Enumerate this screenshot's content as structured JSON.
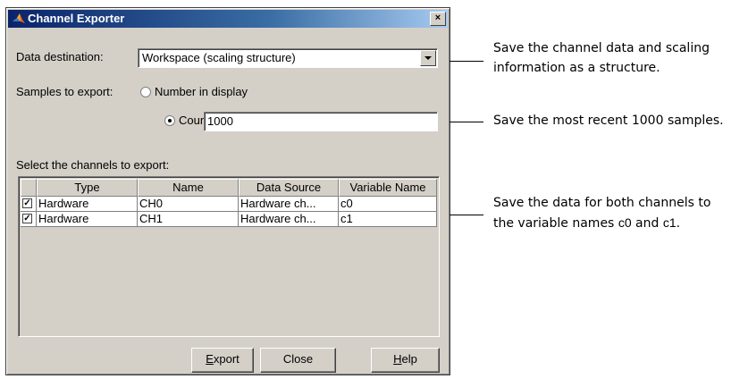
{
  "window": {
    "title": "Channel Exporter",
    "close_glyph": "×"
  },
  "destination": {
    "label": "Data destination:",
    "value": "Workspace (scaling structure)"
  },
  "samples": {
    "label": "Samples to export:",
    "option_display": "Number in display",
    "option_count": "Count",
    "count_value": "1000",
    "selected": "count"
  },
  "channels": {
    "label": "Select the channels to export:",
    "columns": [
      "Type",
      "Name",
      "Data Source",
      "Variable Name"
    ],
    "rows": [
      {
        "checked": true,
        "type": "Hardware",
        "name": "CH0",
        "source": "Hardware ch...",
        "variable": "c0"
      },
      {
        "checked": true,
        "type": "Hardware",
        "name": "CH1",
        "source": "Hardware ch...",
        "variable": "c1"
      }
    ]
  },
  "buttons": {
    "export_mnemonic": "E",
    "export_rest": "xport",
    "close": "Close",
    "help_mnemonic": "H",
    "help_rest": "elp"
  },
  "callouts": {
    "c1_line1": "Save the channel data and scaling",
    "c1_line2": "information as a structure.",
    "c2": "Save the most recent 1000 samples.",
    "c3_line1": "Save the data for both channels to",
    "c3_pre": "the variable names ",
    "c3_v0": "c0",
    "c3_mid": " and ",
    "c3_v1": "c1",
    "c3_end": "."
  },
  "colors": {
    "titlebar": "#0a246a",
    "face": "#d4d0c8"
  }
}
